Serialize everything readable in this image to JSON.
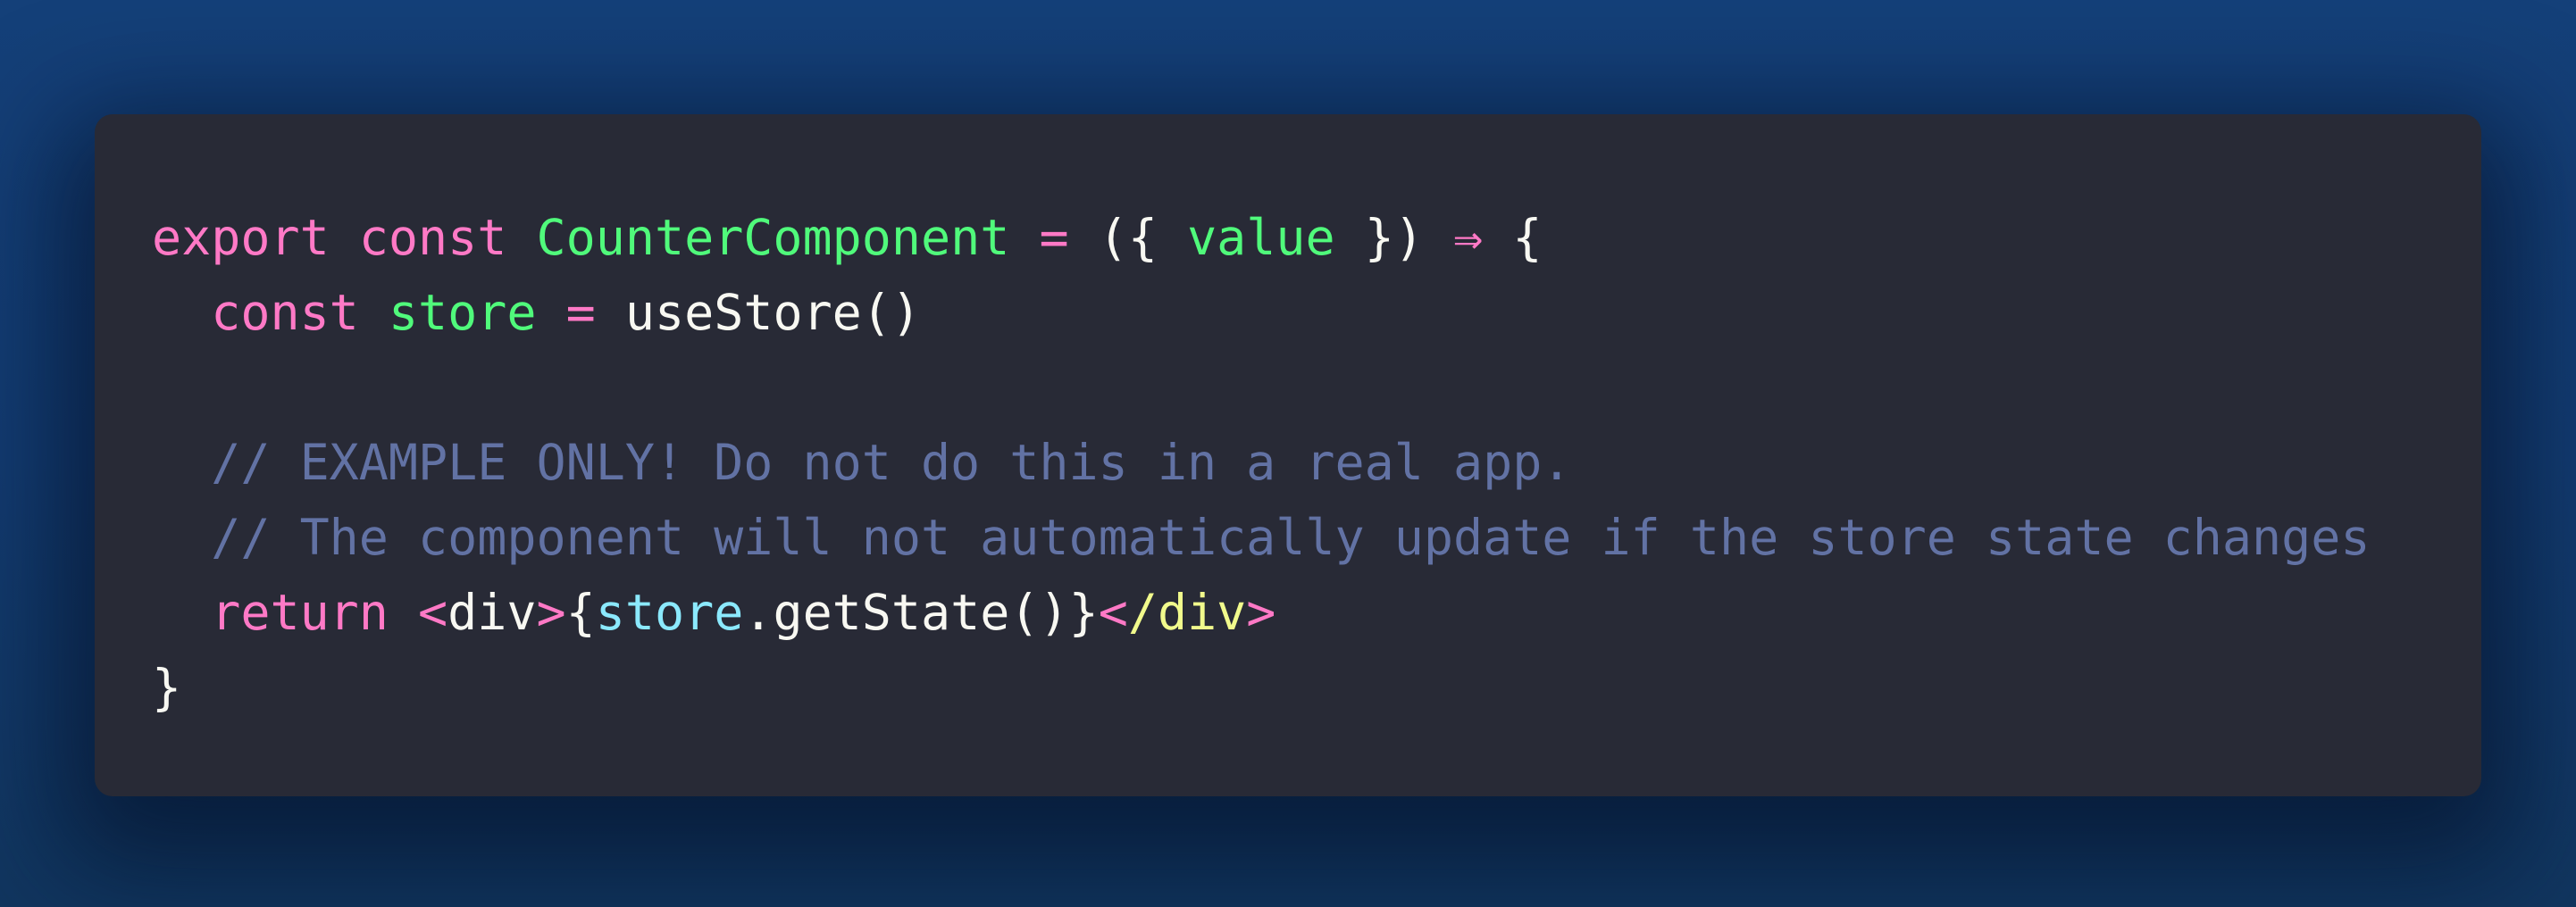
{
  "colors": {
    "background": "#133f76",
    "panel": "#282a36",
    "keyword": "#ff79c6",
    "function": "#50fa7b",
    "text": "#f8f8f2",
    "comment": "#6272a4",
    "tag": "#f1fa8c",
    "variable": "#8be9fd"
  },
  "code": {
    "line1": {
      "kw_export": "export",
      "kw_const": "const",
      "name": "CounterComponent",
      "eq": "=",
      "paren_open": "({",
      "param": "value",
      "paren_close": "})",
      "arrow": "⇒",
      "brace": "{"
    },
    "line2": {
      "kw_const": "const",
      "name": "store",
      "eq": "=",
      "call": "useStore()"
    },
    "line4": {
      "comment": "// EXAMPLE ONLY! Do not do this in a real app."
    },
    "line5": {
      "comment": "// The component will not automatically update if the store state changes"
    },
    "line6": {
      "kw_return": "return",
      "lt": "<",
      "div_open": "div",
      "gt": ">",
      "brace_open": "{",
      "store": "store",
      "method": ".getState()",
      "brace_close": "}",
      "close_lt": "<",
      "close_tag": "/div",
      "close_gt": ">"
    },
    "line7": {
      "brace": "}"
    }
  }
}
